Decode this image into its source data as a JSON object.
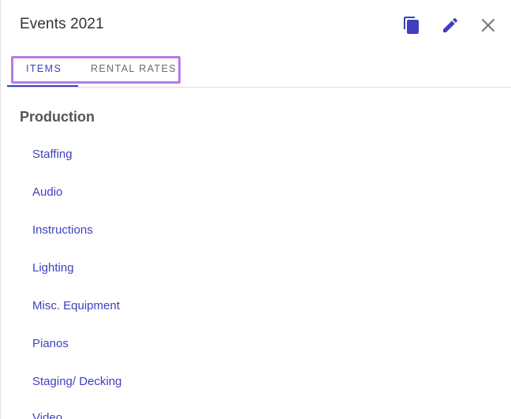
{
  "header": {
    "title": "Events 2021",
    "actions": [
      {
        "name": "copy",
        "icon": "copy-document-icon"
      },
      {
        "name": "edit",
        "icon": "pencil-icon"
      },
      {
        "name": "close",
        "icon": "close-icon"
      }
    ]
  },
  "tabs": [
    {
      "label": "ITEMS",
      "active": true
    },
    {
      "label": "RENTAL RATES",
      "active": false
    }
  ],
  "section": {
    "heading": "Production",
    "items": [
      {
        "label": "Staffing"
      },
      {
        "label": "Audio"
      },
      {
        "label": "Instructions"
      },
      {
        "label": "Lighting"
      },
      {
        "label": "Misc. Equipment"
      },
      {
        "label": "Pianos"
      },
      {
        "label": "Staging/ Decking"
      },
      {
        "label": "Video"
      }
    ]
  },
  "colors": {
    "accent": "#3f3fbf",
    "highlight": "#b57ce6",
    "icon_gray": "#757575",
    "title_text": "#333333",
    "heading_text": "#555555"
  }
}
